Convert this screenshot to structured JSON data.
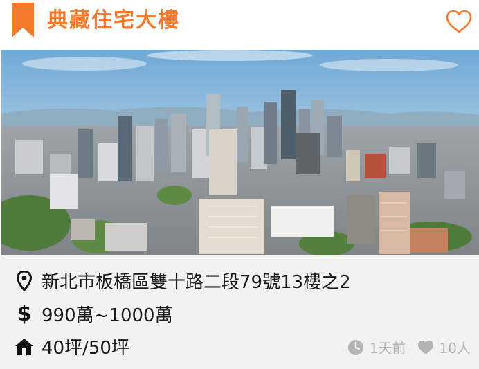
{
  "header": {
    "title": "典藏住宅大樓"
  },
  "listing": {
    "address": "新北市板橋區雙十路二段79號13樓之2",
    "currency_symbol": "$",
    "price": "990萬~1000萬",
    "size": "40坪/50坪"
  },
  "meta": {
    "posted": "1天前",
    "likes": "10人"
  },
  "icons": {
    "bookmark": "bookmark-icon",
    "favorite": "heart-outline-icon",
    "location": "map-pin-icon",
    "price": "dollar-icon",
    "size": "home-icon",
    "time": "clock-icon",
    "likes": "heart-icon"
  },
  "colors": {
    "accent": "#F57A2B",
    "panel": "#F2F2F2",
    "muted": "#B3B3B3",
    "text": "#1a1a1a"
  }
}
